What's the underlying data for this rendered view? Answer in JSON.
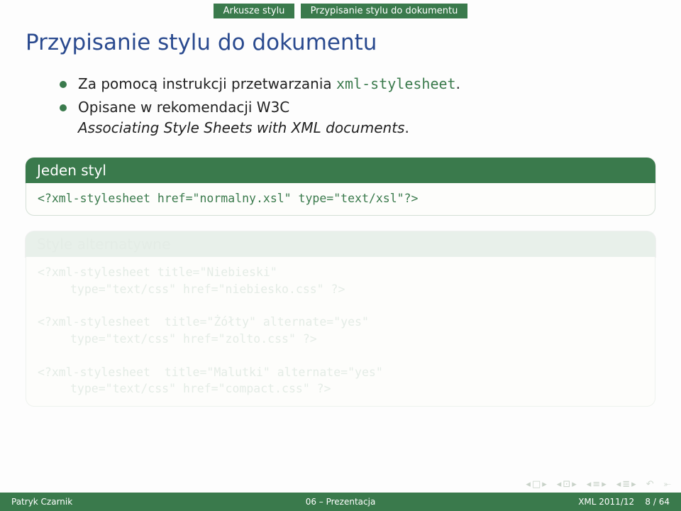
{
  "topbar": {
    "left": "Arkusze stylu",
    "right": "Przypisanie stylu do dokumentu"
  },
  "title": "Przypisanie stylu do dokumentu",
  "bullets": {
    "b1_pre": "Za pomocą instrukcji przetwarzania ",
    "b1_code": "xml-stylesheet",
    "b1_post": ".",
    "b2": "Opisane w rekomendacji W3C",
    "b2_em": "Associating Style Sheets with XML documents",
    "b2_post": "."
  },
  "block1": {
    "title": "Jeden styl",
    "code": "<?xml-stylesheet href=\"normalny.xsl\" type=\"text/xsl\"?>"
  },
  "block2": {
    "title": "Style alternatywne",
    "l1": "<?xml-stylesheet title=\"Niebieski\"",
    "l2": "type=\"text/css\" href=\"niebiesko.css\" ?>",
    "l3": "<?xml-stylesheet  title=\"Żółty\" alternate=\"yes\"",
    "l4": "type=\"text/css\" href=\"zolto.css\" ?>",
    "l5": "<?xml-stylesheet  title=\"Malutki\" alternate=\"yes\"",
    "l6": "type=\"text/css\" href=\"compact.css\" ?>"
  },
  "footer": {
    "left": "Patryk Czarnik",
    "center": "06 – Prezentacja",
    "right_a": "XML 2011/12",
    "right_b": "8 / 64"
  }
}
